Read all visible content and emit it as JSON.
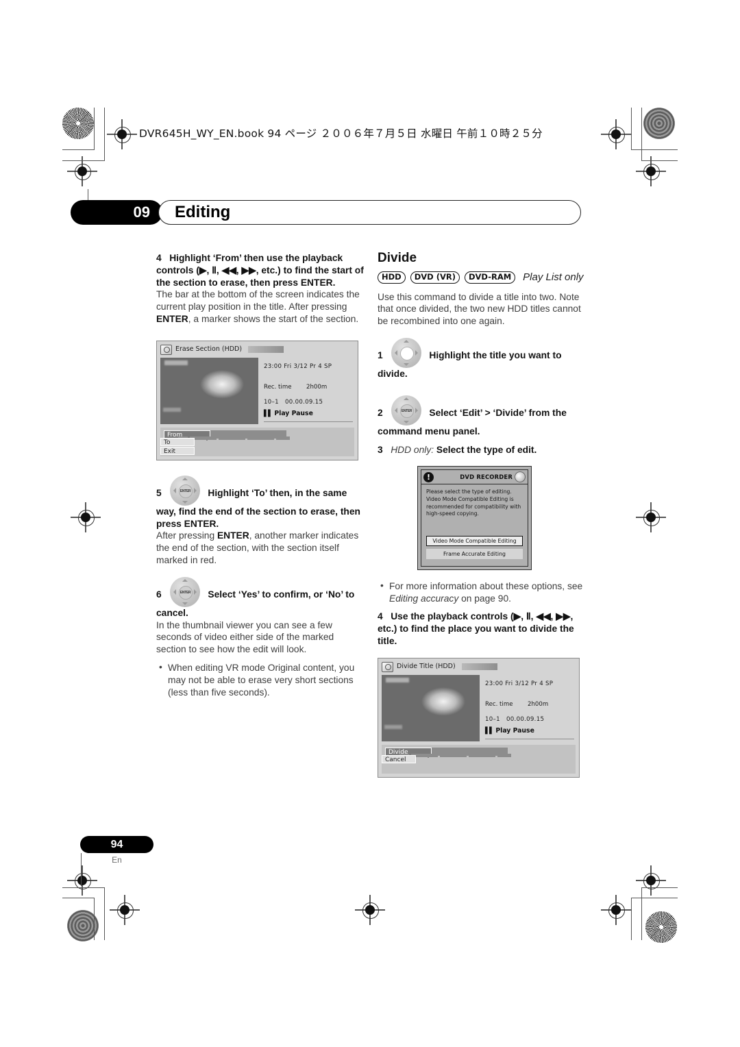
{
  "print_header": {
    "book_line": "DVR645H_WY_EN.book  94 ページ  ２００６年７月５日  水曜日  午前１０時２５分"
  },
  "chapter": {
    "number": "09",
    "title": "Editing"
  },
  "left_column": {
    "step4": {
      "num": "4",
      "bold": "Highlight ‘From’ then use the playback controls (▶, Ⅱ, ◀◀, ▶▶, etc.) to find the start of the section to erase, then press ENTER.",
      "body_a": "The bar at the bottom of the screen indicates the current play position in the title. After pressing ",
      "body_b": "ENTER",
      "body_c": ", a marker shows the start of the section."
    },
    "screenshot": {
      "title": "Erase Section  (HDD)",
      "info_line1": "23:00  Fri   3/12  Pr 4    SP",
      "rec_time_label": "Rec. time",
      "rec_time_value": "2h00m",
      "counter_title": "10–1",
      "counter_time": "00.00.09.15",
      "play_state": "Play Pause",
      "btn_primary": "From",
      "btn_second": "To",
      "btn_third": "Exit"
    },
    "step5": {
      "num": "5",
      "bold": "Highlight ‘To’ then, in the same way, find the end of the section to erase, then press ENTER.",
      "body_a": "After pressing ",
      "body_b": "ENTER",
      "body_c": ", another marker indicates the end of the section, with the section itself marked in red."
    },
    "step6": {
      "num": "6",
      "bold": "Select ‘Yes’ to confirm, or ‘No’ to cancel.",
      "body": "In the thumbnail viewer you can see a few seconds of video either side of the marked section to see how the edit will look.",
      "bullet": "When editing VR mode Original content, you may not be able to erase very short sections (less than five seconds)."
    }
  },
  "right_column": {
    "section_title": "Divide",
    "badges": [
      "HDD",
      "DVD (VR)",
      "DVD-RAM"
    ],
    "badge_note": "Play List only",
    "intro": "Use this command to divide a title into two. Note that once divided, the two new HDD titles cannot be recombined into one again.",
    "step1": {
      "num": "1",
      "bold": "Highlight the title you want to divide."
    },
    "step2": {
      "num": "2",
      "bold": "Select ‘Edit’ > ‘Divide’ from the command menu panel."
    },
    "step3": {
      "num": "3",
      "italic": "HDD only:",
      "bold": " Select the type of edit."
    },
    "dialog": {
      "header_title": "DVD RECORDER",
      "body": "Please select the type of editing. Video Mode Compatible Editing is recommended for compatibility with high-speed copying.",
      "btn_selected": "Video Mode Compatible Editing",
      "btn_unselected": "Frame Accurate Editing"
    },
    "bullet_a": "For more information about these options, see ",
    "bullet_italic": "Editing accuracy",
    "bullet_b": " on page 90.",
    "step4": {
      "num": "4",
      "bold": "Use the playback controls (▶, Ⅱ, ◀◀, ▶▶, etc.) to find the place you want to divide the title."
    },
    "screenshot": {
      "title": "Divide Title  (HDD)",
      "info_line1": "23:00  Fri   3/12  Pr 4    SP",
      "rec_time_label": "Rec. time",
      "rec_time_value": "2h00m",
      "counter_title": "10–1",
      "counter_time": "00.00.09.15",
      "play_state": "Play Pause",
      "btn_primary": "Divide",
      "btn_second": "Cancel"
    }
  },
  "footer": {
    "page_number": "94",
    "language": "En"
  },
  "icons": {
    "dpad_enter_label": "ENTER",
    "exclamation": "!"
  }
}
